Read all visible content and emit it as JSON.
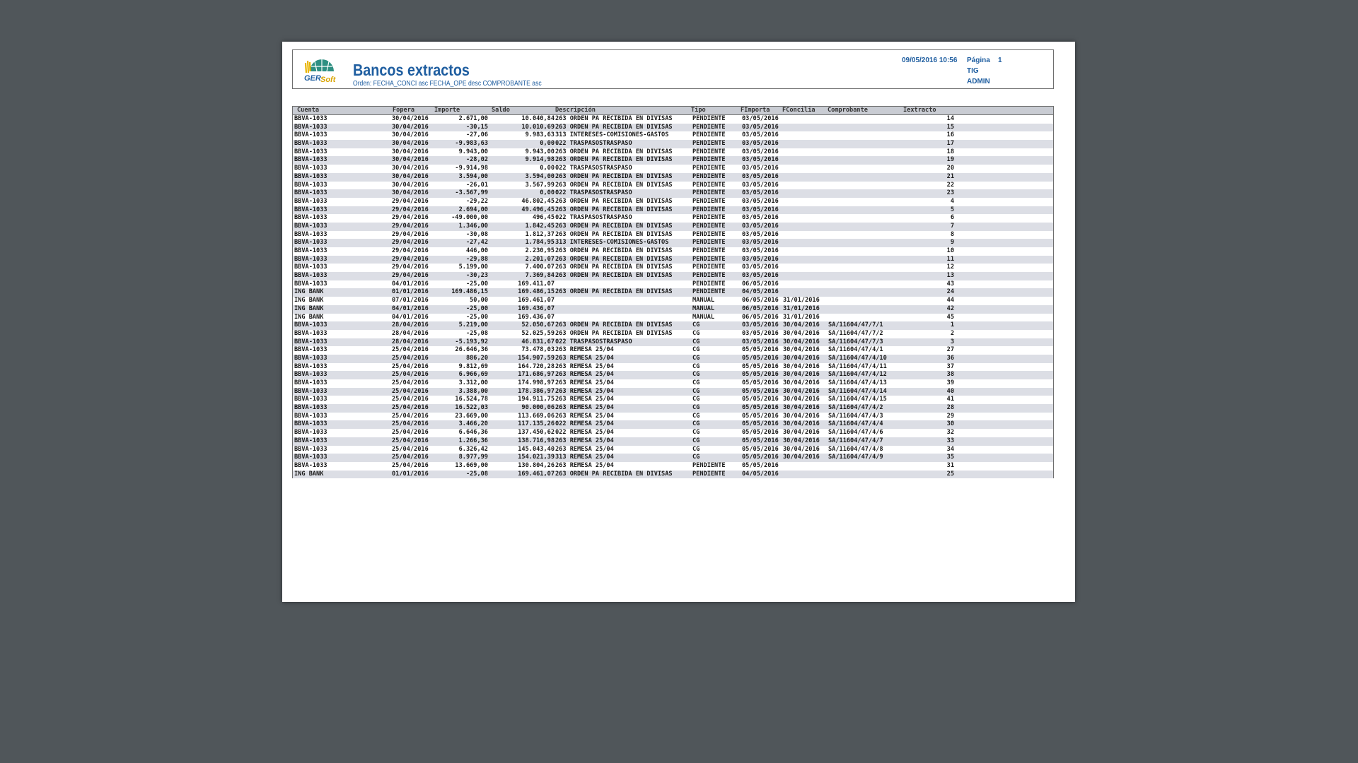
{
  "report": {
    "title": "Bancos extractos",
    "subtitle": "Orden: FECHA_CONCI asc FECHA_OPE desc COMPROBANTE asc",
    "datetime": "09/05/2016 10:56",
    "page_label": "Página",
    "page_number": "1",
    "line2": "TIG",
    "line3": "ADMIN",
    "logo_text": "GERSoft"
  },
  "table": {
    "headers": [
      "Cuenta",
      "Fopera",
      "Importe",
      "Saldo",
      "Descripción",
      "Tipo",
      "FImporta",
      "FConcilia",
      "Comprobante",
      "Iextracto"
    ],
    "rows": [
      [
        "BBVA-1033",
        "30/04/2016",
        "2.671,00",
        "10.040,84",
        "263 ORDEN PA RECIBIDA EN DIVISAS",
        "PENDIENTE",
        "03/05/2016",
        "",
        "",
        "14"
      ],
      [
        "BBVA-1033",
        "30/04/2016",
        "-30,15",
        "10.010,69",
        "263 ORDEN PA RECIBIDA EN DIVISAS",
        "PENDIENTE",
        "03/05/2016",
        "",
        "",
        "15"
      ],
      [
        "BBVA-1033",
        "30/04/2016",
        "-27,06",
        "9.983,63",
        "313 INTERESES-COMISIONES-GASTOS",
        "PENDIENTE",
        "03/05/2016",
        "",
        "",
        "16"
      ],
      [
        "BBVA-1033",
        "30/04/2016",
        "-9.983,63",
        "0,00",
        "022 TRASPASOSTRASPASO",
        "PENDIENTE",
        "03/05/2016",
        "",
        "",
        "17"
      ],
      [
        "BBVA-1033",
        "30/04/2016",
        "9.943,00",
        "9.943,00",
        "263 ORDEN PA RECIBIDA EN DIVISAS",
        "PENDIENTE",
        "03/05/2016",
        "",
        "",
        "18"
      ],
      [
        "BBVA-1033",
        "30/04/2016",
        "-28,02",
        "9.914,98",
        "263 ORDEN PA RECIBIDA EN DIVISAS",
        "PENDIENTE",
        "03/05/2016",
        "",
        "",
        "19"
      ],
      [
        "BBVA-1033",
        "30/04/2016",
        "-9.914,98",
        "0,00",
        "022 TRASPASOSTRASPASO",
        "PENDIENTE",
        "03/05/2016",
        "",
        "",
        "20"
      ],
      [
        "BBVA-1033",
        "30/04/2016",
        "3.594,00",
        "3.594,00",
        "263 ORDEN PA RECIBIDA EN DIVISAS",
        "PENDIENTE",
        "03/05/2016",
        "",
        "",
        "21"
      ],
      [
        "BBVA-1033",
        "30/04/2016",
        "-26,01",
        "3.567,99",
        "263 ORDEN PA RECIBIDA EN DIVISAS",
        "PENDIENTE",
        "03/05/2016",
        "",
        "",
        "22"
      ],
      [
        "BBVA-1033",
        "30/04/2016",
        "-3.567,99",
        "0,00",
        "022 TRASPASOSTRASPASO",
        "PENDIENTE",
        "03/05/2016",
        "",
        "",
        "23"
      ],
      [
        "BBVA-1033",
        "29/04/2016",
        "-29,22",
        "46.802,45",
        "263 ORDEN PA RECIBIDA EN DIVISAS",
        "PENDIENTE",
        "03/05/2016",
        "",
        "",
        "4"
      ],
      [
        "BBVA-1033",
        "29/04/2016",
        "2.694,00",
        "49.496,45",
        "263 ORDEN PA RECIBIDA EN DIVISAS",
        "PENDIENTE",
        "03/05/2016",
        "",
        "",
        "5"
      ],
      [
        "BBVA-1033",
        "29/04/2016",
        "-49.000,00",
        "496,45",
        "022 TRASPASOSTRASPASO",
        "PENDIENTE",
        "03/05/2016",
        "",
        "",
        "6"
      ],
      [
        "BBVA-1033",
        "29/04/2016",
        "1.346,00",
        "1.842,45",
        "263 ORDEN PA RECIBIDA EN DIVISAS",
        "PENDIENTE",
        "03/05/2016",
        "",
        "",
        "7"
      ],
      [
        "BBVA-1033",
        "29/04/2016",
        "-30,08",
        "1.812,37",
        "263 ORDEN PA RECIBIDA EN DIVISAS",
        "PENDIENTE",
        "03/05/2016",
        "",
        "",
        "8"
      ],
      [
        "BBVA-1033",
        "29/04/2016",
        "-27,42",
        "1.784,95",
        "313 INTERESES-COMISIONES-GASTOS",
        "PENDIENTE",
        "03/05/2016",
        "",
        "",
        "9"
      ],
      [
        "BBVA-1033",
        "29/04/2016",
        "446,00",
        "2.230,95",
        "263 ORDEN PA RECIBIDA EN DIVISAS",
        "PENDIENTE",
        "03/05/2016",
        "",
        "",
        "10"
      ],
      [
        "BBVA-1033",
        "29/04/2016",
        "-29,88",
        "2.201,07",
        "263 ORDEN PA RECIBIDA EN DIVISAS",
        "PENDIENTE",
        "03/05/2016",
        "",
        "",
        "11"
      ],
      [
        "BBVA-1033",
        "29/04/2016",
        "5.199,00",
        "7.400,07",
        "263 ORDEN PA RECIBIDA EN DIVISAS",
        "PENDIENTE",
        "03/05/2016",
        "",
        "",
        "12"
      ],
      [
        "BBVA-1033",
        "29/04/2016",
        "-30,23",
        "7.369,84",
        "263 ORDEN PA RECIBIDA EN DIVISAS",
        "PENDIENTE",
        "03/05/2016",
        "",
        "",
        "13"
      ],
      [
        "BBVA-1033",
        "04/01/2016",
        "-25,00",
        "169.411,07",
        "",
        "PENDIENTE",
        "06/05/2016",
        "",
        "",
        "43"
      ],
      [
        "ING BANK",
        "01/01/2016",
        "169.486,15",
        "169.486,15",
        "263 ORDEN PA RECIBIDA EN DIVISAS",
        "PENDIENTE",
        "04/05/2016",
        "",
        "",
        "24"
      ],
      [
        "ING BANK",
        "07/01/2016",
        "50,00",
        "169.461,07",
        "",
        "MANUAL",
        "06/05/2016",
        "31/01/2016",
        "",
        "44"
      ],
      [
        "ING BANK",
        "04/01/2016",
        "-25,00",
        "169.436,07",
        "",
        "MANUAL",
        "06/05/2016",
        "31/01/2016",
        "",
        "42"
      ],
      [
        "ING BANK",
        "04/01/2016",
        "-25,00",
        "169.436,07",
        "",
        "MANUAL",
        "06/05/2016",
        "31/01/2016",
        "",
        "45"
      ],
      [
        "BBVA-1033",
        "28/04/2016",
        "5.219,00",
        "52.050,67",
        "263 ORDEN PA RECIBIDA EN DIVISAS",
        "CG",
        "03/05/2016",
        "30/04/2016",
        "SA/11604/47/7/1",
        "1"
      ],
      [
        "BBVA-1033",
        "28/04/2016",
        "-25,08",
        "52.025,59",
        "263 ORDEN PA RECIBIDA EN DIVISAS",
        "CG",
        "03/05/2016",
        "30/04/2016",
        "SA/11604/47/7/2",
        "2"
      ],
      [
        "BBVA-1033",
        "28/04/2016",
        "-5.193,92",
        "46.831,67",
        "022 TRASPASOSTRASPASO",
        "CG",
        "03/05/2016",
        "30/04/2016",
        "SA/11604/47/7/3",
        "3"
      ],
      [
        "BBVA-1033",
        "25/04/2016",
        "26.646,36",
        "73.478,03",
        "263 REMESA 25/04",
        "CG",
        "05/05/2016",
        "30/04/2016",
        "SA/11604/47/4/1",
        "27"
      ],
      [
        "BBVA-1033",
        "25/04/2016",
        "886,20",
        "154.907,59",
        "263 REMESA 25/04",
        "CG",
        "05/05/2016",
        "30/04/2016",
        "SA/11604/47/4/10",
        "36"
      ],
      [
        "BBVA-1033",
        "25/04/2016",
        "9.812,69",
        "164.720,28",
        "263 REMESA 25/04",
        "CG",
        "05/05/2016",
        "30/04/2016",
        "SA/11604/47/4/11",
        "37"
      ],
      [
        "BBVA-1033",
        "25/04/2016",
        "6.966,69",
        "171.686,97",
        "263 REMESA 25/04",
        "CG",
        "05/05/2016",
        "30/04/2016",
        "SA/11604/47/4/12",
        "38"
      ],
      [
        "BBVA-1033",
        "25/04/2016",
        "3.312,00",
        "174.998,97",
        "263 REMESA 25/04",
        "CG",
        "05/05/2016",
        "30/04/2016",
        "SA/11604/47/4/13",
        "39"
      ],
      [
        "BBVA-1033",
        "25/04/2016",
        "3.388,00",
        "178.386,97",
        "263 REMESA 25/04",
        "CG",
        "05/05/2016",
        "30/04/2016",
        "SA/11604/47/4/14",
        "40"
      ],
      [
        "BBVA-1033",
        "25/04/2016",
        "16.524,78",
        "194.911,75",
        "263 REMESA 25/04",
        "CG",
        "05/05/2016",
        "30/04/2016",
        "SA/11604/47/4/15",
        "41"
      ],
      [
        "BBVA-1033",
        "25/04/2016",
        "16.522,03",
        "90.000,06",
        "263 REMESA 25/04",
        "CG",
        "05/05/2016",
        "30/04/2016",
        "SA/11604/47/4/2",
        "28"
      ],
      [
        "BBVA-1033",
        "25/04/2016",
        "23.669,00",
        "113.669,06",
        "263 REMESA 25/04",
        "CG",
        "05/05/2016",
        "30/04/2016",
        "SA/11604/47/4/3",
        "29"
      ],
      [
        "BBVA-1033",
        "25/04/2016",
        "3.466,20",
        "117.135,26",
        "022 REMESA 25/04",
        "CG",
        "05/05/2016",
        "30/04/2016",
        "SA/11604/47/4/4",
        "30"
      ],
      [
        "BBVA-1033",
        "25/04/2016",
        "6.646,36",
        "137.450,62",
        "022 REMESA 25/04",
        "CG",
        "05/05/2016",
        "30/04/2016",
        "SA/11604/47/4/6",
        "32"
      ],
      [
        "BBVA-1033",
        "25/04/2016",
        "1.266,36",
        "138.716,98",
        "263 REMESA 25/04",
        "CG",
        "05/05/2016",
        "30/04/2016",
        "SA/11604/47/4/7",
        "33"
      ],
      [
        "BBVA-1033",
        "25/04/2016",
        "6.326,42",
        "145.043,40",
        "263 REMESA 25/04",
        "CG",
        "05/05/2016",
        "30/04/2016",
        "SA/11604/47/4/8",
        "34"
      ],
      [
        "BBVA-1033",
        "25/04/2016",
        "8.977,99",
        "154.021,39",
        "313 REMESA 25/04",
        "CG",
        "05/05/2016",
        "30/04/2016",
        "SA/11604/47/4/9",
        "35"
      ],
      [
        "BBVA-1033",
        "25/04/2016",
        "13.669,00",
        "130.804,26",
        "263 REMESA 25/04",
        "PENDIENTE",
        "05/05/2016",
        "",
        "",
        "31"
      ],
      [
        "ING BANK",
        "01/01/2016",
        "-25,08",
        "169.461,07",
        "263 ORDEN PA RECIBIDA EN DIVISAS",
        "PENDIENTE",
        "04/05/2016",
        "",
        "",
        "25"
      ]
    ]
  }
}
